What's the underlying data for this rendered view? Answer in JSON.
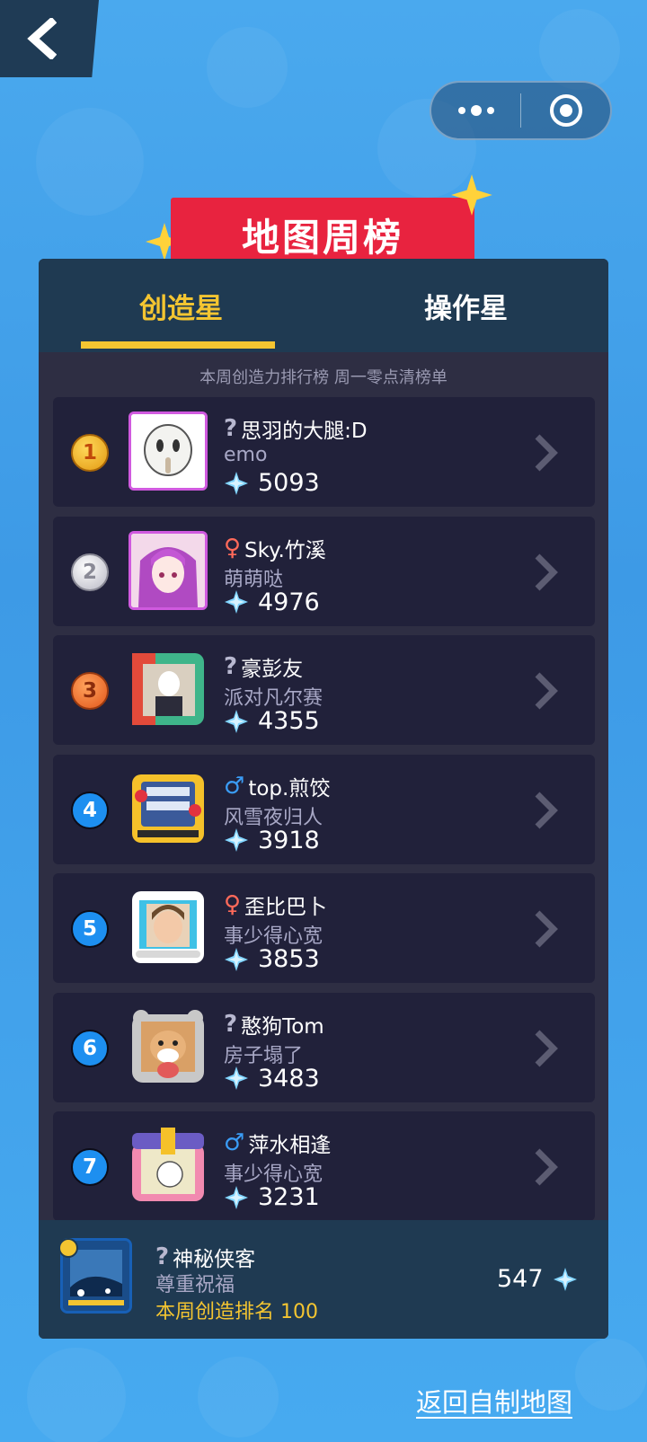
{
  "banner": {
    "title": "地图周榜"
  },
  "tabs": [
    {
      "label": "创造星",
      "active": true
    },
    {
      "label": "操作星",
      "active": false
    }
  ],
  "subtitle": "本周创造力排行榜 周一零点清榜单",
  "ranking": [
    {
      "rank": "1",
      "gender": "?",
      "name": "思羽的大腿:D",
      "map": "emo",
      "score": "5093"
    },
    {
      "rank": "2",
      "gender": "♀",
      "name": "Sky.竹溪",
      "map": "萌萌哒",
      "score": "4976"
    },
    {
      "rank": "3",
      "gender": "?",
      "name": "豪彭友",
      "map": "派对凡尔赛",
      "score": "4355"
    },
    {
      "rank": "4",
      "gender": "♂",
      "name": "top.煎饺",
      "map": "风雪夜归人",
      "score": "3918"
    },
    {
      "rank": "5",
      "gender": "♀",
      "name": "歪比巴卜",
      "map": "事少得心宽",
      "score": "3853"
    },
    {
      "rank": "6",
      "gender": "?",
      "name": "憨狗Tom",
      "map": "房子塌了",
      "score": "3483"
    },
    {
      "rank": "7",
      "gender": "♂",
      "name": "萍水相逢",
      "map": "事少得心宽",
      "score": "3231"
    }
  ],
  "me": {
    "gender": "?",
    "name": "神秘侠客",
    "map": "尊重祝福",
    "rank_text": "本周创造排名 100",
    "score": "547"
  },
  "return_link": "返回自制地图",
  "colors": {
    "background": "#47aaf0",
    "panel": "#2e2e43",
    "accent_yellow": "#f4c531",
    "banner_red": "#e8233f"
  }
}
